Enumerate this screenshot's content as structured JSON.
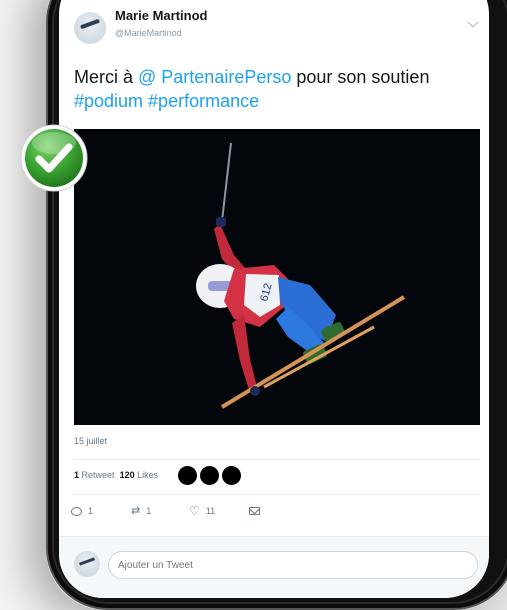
{
  "tweet": {
    "author_name": "Marie Martinod",
    "author_handle": "@MarieMartinod",
    "text_prefix": "Merci à ",
    "mention": "@ PartenairePerso",
    "text_mid": " pour son soutien",
    "hashtags": "#podium #performance",
    "date": "15 juillet",
    "retweets_count": "1",
    "retweets_label": "Retweet",
    "likes_count": "120",
    "likes_label": "Likes",
    "actions": {
      "reply": "1",
      "retweet": "1",
      "like": "11"
    }
  },
  "reply_bar": {
    "placeholder": "Ajouter un Tweet"
  },
  "icons": {
    "check": "green-check-icon",
    "chevron": "chevron-down-icon",
    "reply": "reply-icon",
    "retweet": "retweet-icon",
    "like": "heart-icon",
    "dm": "envelope-icon"
  },
  "colors": {
    "link": "#1da1f2",
    "check_green": "#3aa232"
  }
}
